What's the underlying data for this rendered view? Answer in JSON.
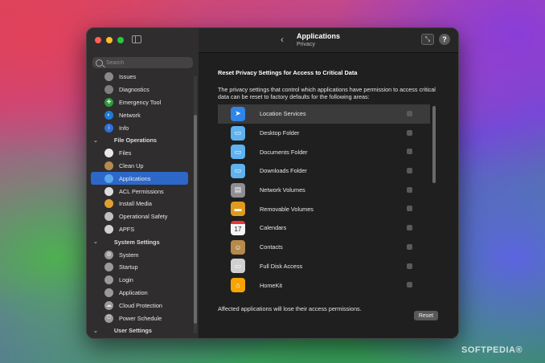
{
  "sidebar": {
    "search_placeholder": "Search",
    "items_top": [
      {
        "label": "Issues",
        "icon": "issues-icon",
        "color": "#8a8a8a"
      },
      {
        "label": "Diagnostics",
        "icon": "stethoscope-icon",
        "color": "#7f7f7f"
      },
      {
        "label": "Emergency Tool",
        "icon": "first-aid-icon",
        "color": "#2e9a3a"
      },
      {
        "label": "Network",
        "icon": "network-icon",
        "color": "#1d7bd6"
      },
      {
        "label": "Info",
        "icon": "info-icon",
        "color": "#2f6fdc"
      }
    ],
    "section_file": "File Operations",
    "items_file": [
      {
        "label": "Files",
        "icon": "files-icon",
        "color": "#e8e8e8"
      },
      {
        "label": "Clean Up",
        "icon": "broom-icon",
        "color": "#b38b4e"
      },
      {
        "label": "Applications",
        "icon": "applications-folder-icon",
        "color": "#5aa8e8",
        "selected": true
      },
      {
        "label": "ACL Permissions",
        "icon": "acl-icon",
        "color": "#dcdcdc"
      },
      {
        "label": "Install Media",
        "icon": "install-media-icon",
        "color": "#e0a030"
      },
      {
        "label": "Operational Safety",
        "icon": "shield-icon",
        "color": "#c0c0c0"
      },
      {
        "label": "APFS",
        "icon": "apfs-icon",
        "color": "#d0d0d0"
      }
    ],
    "section_system": "System Settings",
    "items_system": [
      {
        "label": "System",
        "icon": "gear-icon",
        "color": "#9a9a9a"
      },
      {
        "label": "Startup",
        "icon": "startup-icon",
        "color": "#9a9a9a"
      },
      {
        "label": "Login",
        "icon": "login-icon",
        "color": "#9a9a9a"
      },
      {
        "label": "Application",
        "icon": "application-icon",
        "color": "#9a9a9a"
      },
      {
        "label": "Cloud Protection",
        "icon": "cloud-icon",
        "color": "#9a9a9a"
      },
      {
        "label": "Power Schedule",
        "icon": "power-icon",
        "color": "#9a9a9a"
      }
    ],
    "section_user": "User Settings"
  },
  "toolbar": {
    "title": "Applications",
    "subtitle": "Privacy"
  },
  "main": {
    "section_title": "Reset Privacy Settings for Access to Critical Data",
    "description": "The privacy settings that control which applications have permission to access critical data can be reset to factory defaults for the following areas:",
    "items": [
      {
        "label": "Location Services",
        "icon": "location-arrow-icon",
        "color": "#2f86e8"
      },
      {
        "label": "Desktop Folder",
        "icon": "desktop-folder-icon",
        "color": "#5fb2ef"
      },
      {
        "label": "Documents Folder",
        "icon": "documents-folder-icon",
        "color": "#5fb2ef"
      },
      {
        "label": "Downloads Folder",
        "icon": "downloads-folder-icon",
        "color": "#5fb2ef"
      },
      {
        "label": "Network Volumes",
        "icon": "network-volume-icon",
        "color": "#8e8e93"
      },
      {
        "label": "Removable Volumes",
        "icon": "removable-volume-icon",
        "color": "#e09a1c"
      },
      {
        "label": "Calendars",
        "icon": "calendar-icon",
        "color": "#f4f4f4",
        "calendar_day": "17"
      },
      {
        "label": "Contacts",
        "icon": "contacts-icon",
        "color": "#b58a4a"
      },
      {
        "label": "Full Disk Access",
        "icon": "disk-icon",
        "color": "#cfcfcf"
      },
      {
        "label": "HomeKit",
        "icon": "home-icon",
        "color": "#f6a400"
      }
    ],
    "footer": "Affected applications will lose their access permissions.",
    "reset_label": "Reset"
  },
  "watermark": "SOFTPEDIA®"
}
